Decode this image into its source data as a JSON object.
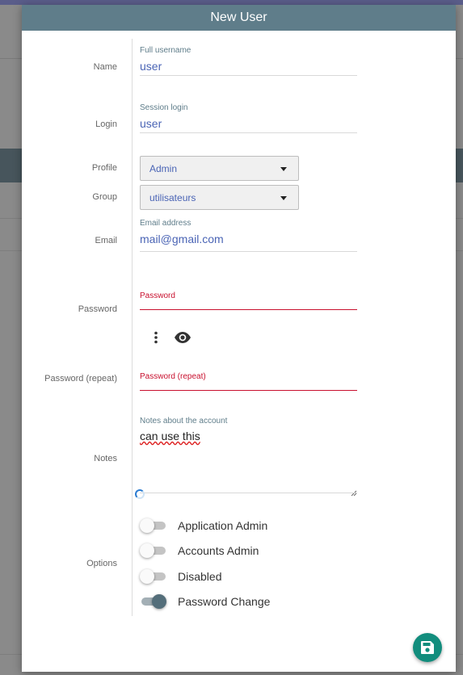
{
  "dialog": {
    "title": "New User"
  },
  "labels": {
    "name": "Name",
    "login": "Login",
    "profile": "Profile",
    "group": "Group",
    "email": "Email",
    "password": "Password",
    "password_repeat": "Password (repeat)",
    "notes": "Notes",
    "options": "Options"
  },
  "fields": {
    "name": {
      "floating_label": "Full username",
      "value": "user"
    },
    "login": {
      "floating_label": "Session login",
      "value": "user"
    },
    "email": {
      "floating_label": "Email address",
      "value": "mail@gmail.com"
    },
    "password": {
      "floating_label": "Password",
      "value": ""
    },
    "password_repeat": {
      "floating_label": "Password (repeat)",
      "value": ""
    },
    "notes": {
      "floating_label": "Notes about the account",
      "value": "can use this"
    }
  },
  "selects": {
    "profile": {
      "value": "Admin"
    },
    "group": {
      "value": "utilisateurs"
    }
  },
  "password_tools": [
    "more-vert-icon",
    "eye-icon"
  ],
  "options": [
    {
      "label": "Application Admin",
      "on": false
    },
    {
      "label": "Accounts Admin",
      "on": false
    },
    {
      "label": "Disabled",
      "on": false
    },
    {
      "label": "Password Change",
      "on": true
    }
  ],
  "colors": {
    "header": "#5f7d8a",
    "accent_text": "#4a64b5",
    "error": "#c8102e",
    "fab": "#128d7d",
    "toggle_on": "#546e7a"
  },
  "save_icon": "save-icon"
}
